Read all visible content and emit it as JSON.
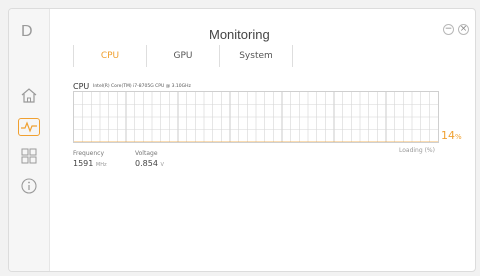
{
  "app": {
    "logo": "D",
    "title": "Monitoring",
    "window_controls": {
      "minimize": "−",
      "close": "×"
    }
  },
  "sidebar": {
    "items": [
      {
        "name": "home",
        "icon": "home-icon",
        "active": false
      },
      {
        "name": "monitoring",
        "icon": "pulse-chart-icon",
        "active": true
      },
      {
        "name": "apps",
        "icon": "grid-icon",
        "active": false
      },
      {
        "name": "info",
        "icon": "info-icon",
        "active": false
      }
    ]
  },
  "tabs": [
    {
      "label": "CPU",
      "active": true
    },
    {
      "label": "GPU",
      "active": false
    },
    {
      "label": "System",
      "active": false
    }
  ],
  "cpu": {
    "label": "CPU",
    "model": "Intel(R) Core(TM) i7-8705G CPU @ 3.10GHz",
    "loading_label": "Loading (%)",
    "current_load": "14",
    "current_load_unit": "%",
    "frequency_label": "Frequency",
    "frequency_value": "1591",
    "frequency_unit": "MHz",
    "voltage_label": "Voltage",
    "voltage_value": "0.854",
    "voltage_unit": "V"
  },
  "colors": {
    "accent": "#f0a030",
    "grid": "#d6d6d6",
    "text": "#444444"
  },
  "chart_data": {
    "type": "line",
    "ylim": [
      0,
      100
    ],
    "series": [
      {
        "values": [
          0,
          0,
          0,
          0,
          0,
          0,
          0,
          0,
          0,
          0,
          0,
          0,
          0,
          0,
          0,
          0,
          0,
          0,
          0,
          0,
          0,
          0,
          0,
          0,
          0,
          0,
          0,
          0,
          0,
          0,
          0,
          0,
          0,
          0,
          0,
          0,
          0,
          0,
          0,
          0,
          0,
          0,
          0,
          0,
          0,
          0,
          0,
          0,
          0,
          0,
          0,
          0,
          0,
          0,
          0,
          0,
          0,
          0,
          0,
          0,
          0,
          0,
          0,
          0,
          0,
          0,
          0,
          0,
          0,
          0,
          0,
          0,
          0,
          0,
          0,
          0,
          0,
          0,
          0,
          0,
          0,
          0,
          0,
          0,
          0,
          0,
          0,
          0,
          0,
          0,
          0,
          0,
          0,
          0,
          0,
          0,
          0,
          0,
          0,
          0,
          0,
          0,
          0,
          0,
          0,
          0,
          0,
          0,
          0,
          0,
          0,
          0,
          0,
          0,
          0,
          0,
          0,
          0,
          0,
          0,
          0,
          0,
          0,
          0,
          0,
          0,
          0,
          0,
          0,
          0,
          0,
          0,
          0,
          0,
          0,
          0,
          0,
          0,
          0,
          0,
          0,
          0,
          0,
          0,
          0,
          0,
          0,
          0,
          0,
          0,
          0,
          0,
          0,
          0,
          0,
          0,
          0,
          0,
          0,
          0,
          0,
          0,
          0,
          0,
          0,
          0,
          0,
          0,
          0,
          0,
          0,
          0,
          0,
          0,
          0,
          0,
          0,
          0,
          0,
          0,
          0,
          0,
          0,
          0,
          0,
          0,
          0,
          0,
          0,
          0,
          0,
          0,
          0,
          0,
          0,
          0,
          0,
          0,
          0,
          0,
          0,
          0,
          0,
          0,
          0,
          0,
          0,
          0,
          0,
          0,
          0,
          0,
          0,
          0,
          0,
          0,
          0,
          0,
          0,
          0,
          0,
          0,
          0,
          0,
          0,
          0,
          0,
          0,
          0,
          0,
          0,
          0,
          0,
          0,
          0,
          0,
          0,
          0,
          0,
          0,
          0,
          0,
          0,
          0,
          0,
          0,
          0,
          0,
          0,
          0,
          0,
          0,
          0,
          0,
          0,
          0,
          0,
          0,
          0,
          0,
          0,
          0,
          0,
          0,
          0,
          0,
          0,
          0,
          0,
          0,
          0,
          0,
          0,
          0,
          0,
          0,
          0,
          0,
          0,
          0,
          0,
          0,
          0,
          0,
          0,
          0,
          0,
          0,
          0,
          0,
          0,
          0,
          0,
          0,
          0,
          0,
          0,
          0,
          0,
          0,
          0,
          0,
          0,
          0,
          0,
          0,
          0,
          0,
          0,
          0,
          0,
          0,
          0,
          0,
          0,
          0,
          0,
          0,
          0,
          0,
          0,
          0,
          0,
          0,
          0,
          0,
          0,
          0,
          0,
          0,
          0,
          0,
          0,
          0,
          0,
          0,
          0,
          0,
          0,
          0,
          0,
          0,
          0,
          0,
          0,
          0,
          0,
          0,
          0,
          0,
          0,
          0,
          0,
          0,
          0,
          0,
          0,
          0,
          0,
          0,
          0,
          0,
          0,
          0,
          0,
          0,
          0
        ]
      }
    ]
  }
}
